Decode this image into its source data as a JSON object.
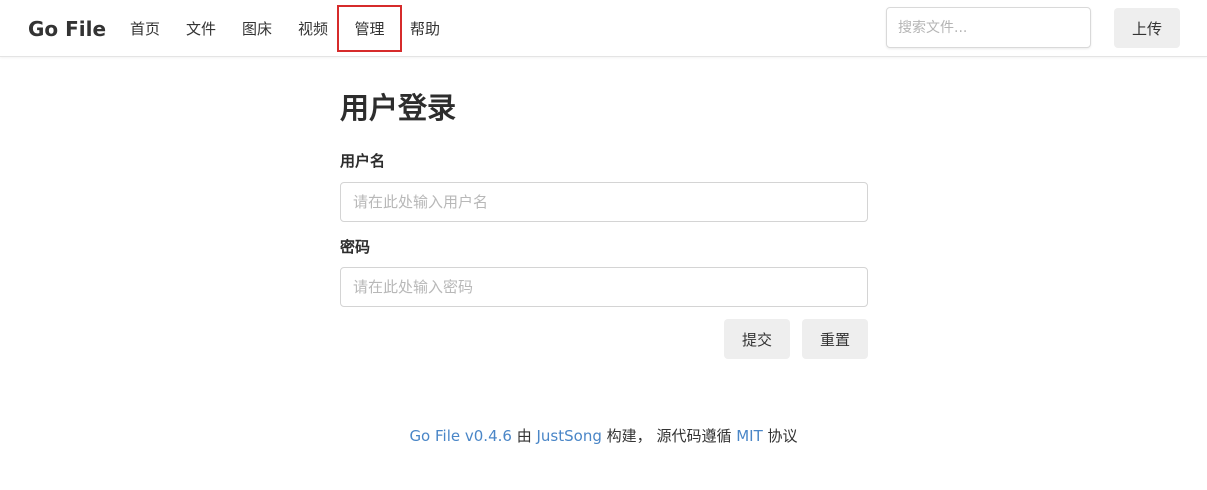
{
  "header": {
    "brand": "Go File",
    "nav": [
      {
        "label": "首页"
      },
      {
        "label": "文件"
      },
      {
        "label": "图床"
      },
      {
        "label": "视频"
      },
      {
        "label": "管理",
        "active": true
      },
      {
        "label": "帮助"
      }
    ],
    "search_placeholder": "搜索文件...",
    "upload_label": "上传"
  },
  "login": {
    "title": "用户登录",
    "username_label": "用户名",
    "username_placeholder": "请在此处输入用户名",
    "password_label": "密码",
    "password_placeholder": "请在此处输入密码",
    "submit_label": "提交",
    "reset_label": "重置"
  },
  "footer": {
    "app_link": "Go File v0.4.6",
    "by": "由",
    "author_link": "JustSong",
    "built": "构建，",
    "license_text": "源代码遵循",
    "license_link": "MIT",
    "protocol": "协议"
  },
  "colors": {
    "link": "#4a86c7",
    "active_outline": "#d62b2b",
    "button_bg": "#eeeeee"
  }
}
